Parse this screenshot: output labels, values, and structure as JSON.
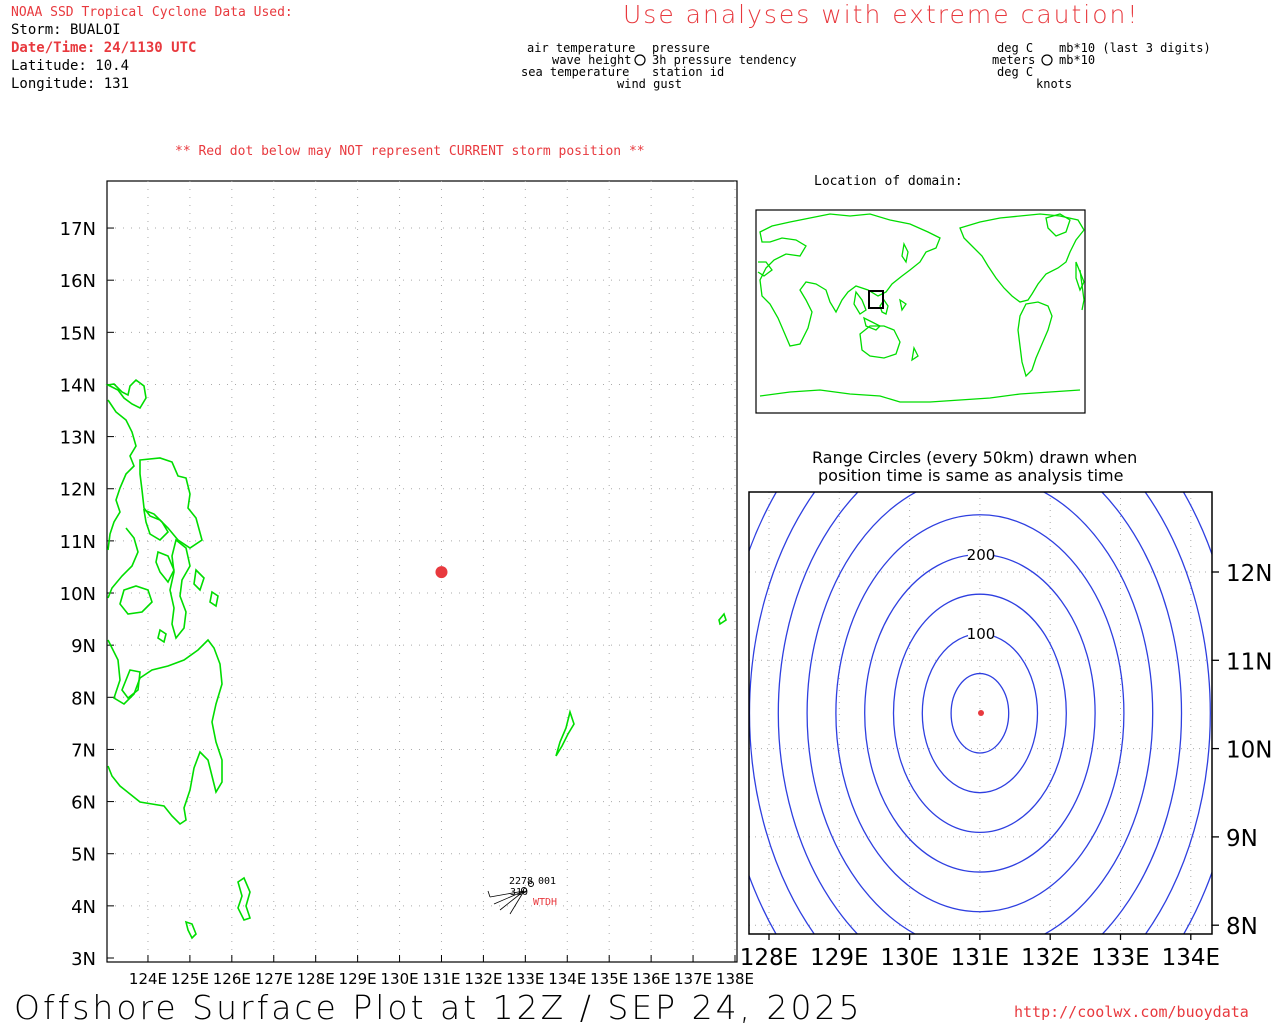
{
  "header": {
    "source": "NOAA SSD Tropical Cyclone Data Used:",
    "storm": "Storm: BUALOI",
    "datetime": "Date/Time: 24/1130 UTC",
    "latitude": "Latitude: 10.4",
    "longitude": "Longitude: 131",
    "caution": "Use analyses with extreme caution!"
  },
  "legend_left": {
    "air_temp": "air temperature",
    "wave_height": "wave height",
    "sea_temp": "sea temperature",
    "pressure": "pressure",
    "tendency": "3h pressure tendency",
    "station_id": "station id",
    "wind_gust": "wind gust"
  },
  "legend_right": {
    "deg_c_1": "deg C",
    "meters": "meters",
    "deg_c_2": "deg C",
    "mb1": "mb*10 (last 3 digits)",
    "mb2": "mb*10",
    "knots": "knots"
  },
  "warning": "** Red dot below may NOT represent CURRENT storm position **",
  "main_map": {
    "lat_labels": [
      "17N",
      "16N",
      "15N",
      "14N",
      "13N",
      "12N",
      "11N",
      "10N",
      "9N",
      "8N",
      "7N",
      "6N",
      "5N",
      "4N",
      "3N"
    ],
    "lon_labels": [
      "124E",
      "125E",
      "126E",
      "127E",
      "128E",
      "129E",
      "130E",
      "131E",
      "132E",
      "133E",
      "134E",
      "135E",
      "136E",
      "137E",
      "138E"
    ],
    "storm_lat": 10.4,
    "storm_lon": 131,
    "station_top": "2278",
    "station_top_right": "001",
    "station_mid": "310",
    "station_id": "WTDH"
  },
  "inset": {
    "title": "Location of domain:"
  },
  "range_plot": {
    "title_line1": "Range Circles (every 50km) drawn when",
    "title_line2": "position time is same as analysis time",
    "label_200": "200",
    "label_100": "100",
    "lon_labels": [
      "128E",
      "129E",
      "130E",
      "131E",
      "132E",
      "133E",
      "134E"
    ],
    "lat_labels": [
      "12N",
      "11N",
      "10N",
      "9N",
      "8N"
    ]
  },
  "footer": {
    "title": "Offshore Surface Plot at 12Z / SEP 24, 2025",
    "url": "http://coolwx.com/buoydata"
  },
  "colors": {
    "coast": "#00dd00",
    "storm": "#e8393e",
    "range_circle": "#2e3fe0"
  }
}
